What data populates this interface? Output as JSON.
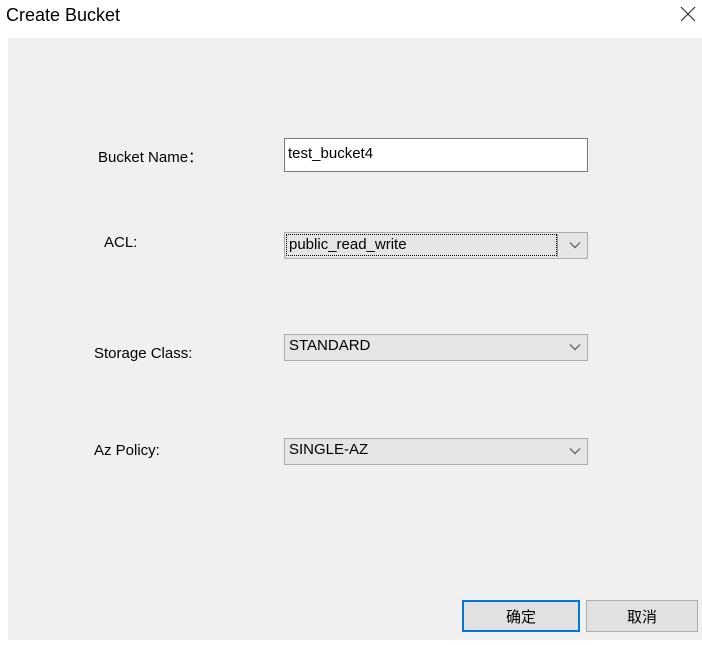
{
  "window": {
    "title": "Create Bucket"
  },
  "form": {
    "bucket_name": {
      "label": "Bucket Name：",
      "value": "test_bucket4"
    },
    "acl": {
      "label": "ACL:",
      "value": "public_read_write"
    },
    "storage_class": {
      "label": "Storage Class:",
      "value": "STANDARD"
    },
    "az_policy": {
      "label": "Az Policy:",
      "value": "SINGLE-AZ"
    }
  },
  "buttons": {
    "ok_label": "确定",
    "cancel_label": "取消"
  },
  "colors": {
    "panel_bg": "#f0f0f0",
    "default_button_border": "#0078d7"
  },
  "icons": {
    "close": "close-icon",
    "dropdown": "chevron-down-icon"
  }
}
